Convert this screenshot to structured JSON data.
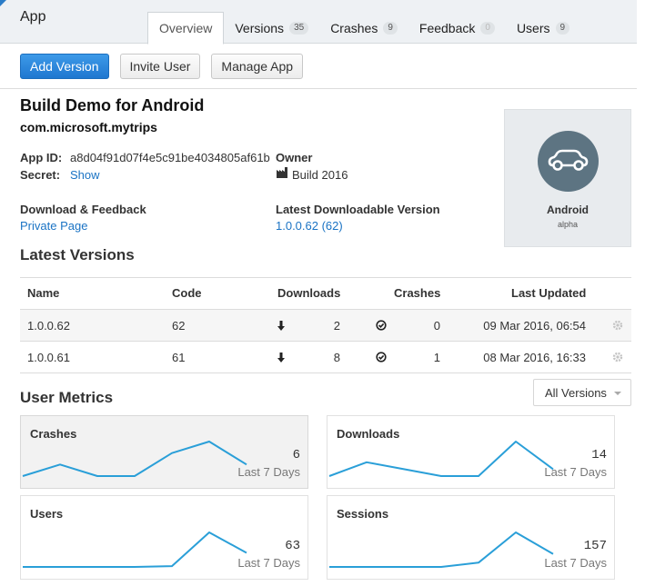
{
  "app": {
    "title": "App"
  },
  "tabs": [
    {
      "label": "Overview",
      "count": ""
    },
    {
      "label": "Versions",
      "count": "35"
    },
    {
      "label": "Crashes",
      "count": "9"
    },
    {
      "label": "Feedback",
      "count": "0"
    },
    {
      "label": "Users",
      "count": "9"
    }
  ],
  "actions": {
    "add_version": "Add Version",
    "invite_user": "Invite User",
    "manage_app": "Manage App"
  },
  "details": {
    "title": "Build Demo for Android",
    "bundle_id": "com.microsoft.mytrips",
    "app_id_label": "App ID:",
    "app_id_value": "a8d04f91d07f4e5c91be4034805af61b",
    "secret_label": "Secret:",
    "secret_link": "Show",
    "owner_label": "Owner",
    "owner_value": "Build 2016",
    "download_label": "Download & Feedback",
    "download_link": "Private Page",
    "latest_label": "Latest Downloadable Version",
    "latest_link": "1.0.0.62 (62)"
  },
  "platform": {
    "name": "Android",
    "release": "alpha",
    "icon": "car-icon",
    "color": "#5d7482"
  },
  "latest_versions": {
    "heading": "Latest Versions",
    "columns": [
      "Name",
      "Code",
      "Downloads",
      "Crashes",
      "Last Updated"
    ],
    "rows": [
      {
        "name": "1.0.0.62",
        "code": "62",
        "downloads": "2",
        "crashes": "0",
        "updated": "09 Mar 2016, 06:54"
      },
      {
        "name": "1.0.0.61",
        "code": "61",
        "downloads": "8",
        "crashes": "1",
        "updated": "08 Mar 2016, 16:33"
      }
    ]
  },
  "metrics": {
    "heading": "User Metrics",
    "filter": "All Versions",
    "accent": "#2a9fd8",
    "cards": [
      {
        "title": "Crashes",
        "value": "6",
        "period": "Last 7 Days",
        "series": [
          0,
          1,
          0,
          0,
          2,
          3,
          1
        ]
      },
      {
        "title": "Downloads",
        "value": "14",
        "period": "Last 7 Days",
        "series": [
          0,
          2,
          1,
          0,
          0,
          5,
          1
        ]
      },
      {
        "title": "Users",
        "value": "63",
        "period": "Last 7 Days",
        "series": [
          0,
          0,
          0,
          0,
          1,
          44,
          18
        ]
      },
      {
        "title": "Sessions",
        "value": "157",
        "period": "Last 7 Days",
        "series": [
          0,
          0,
          0,
          0,
          10,
          80,
          30
        ]
      }
    ]
  }
}
